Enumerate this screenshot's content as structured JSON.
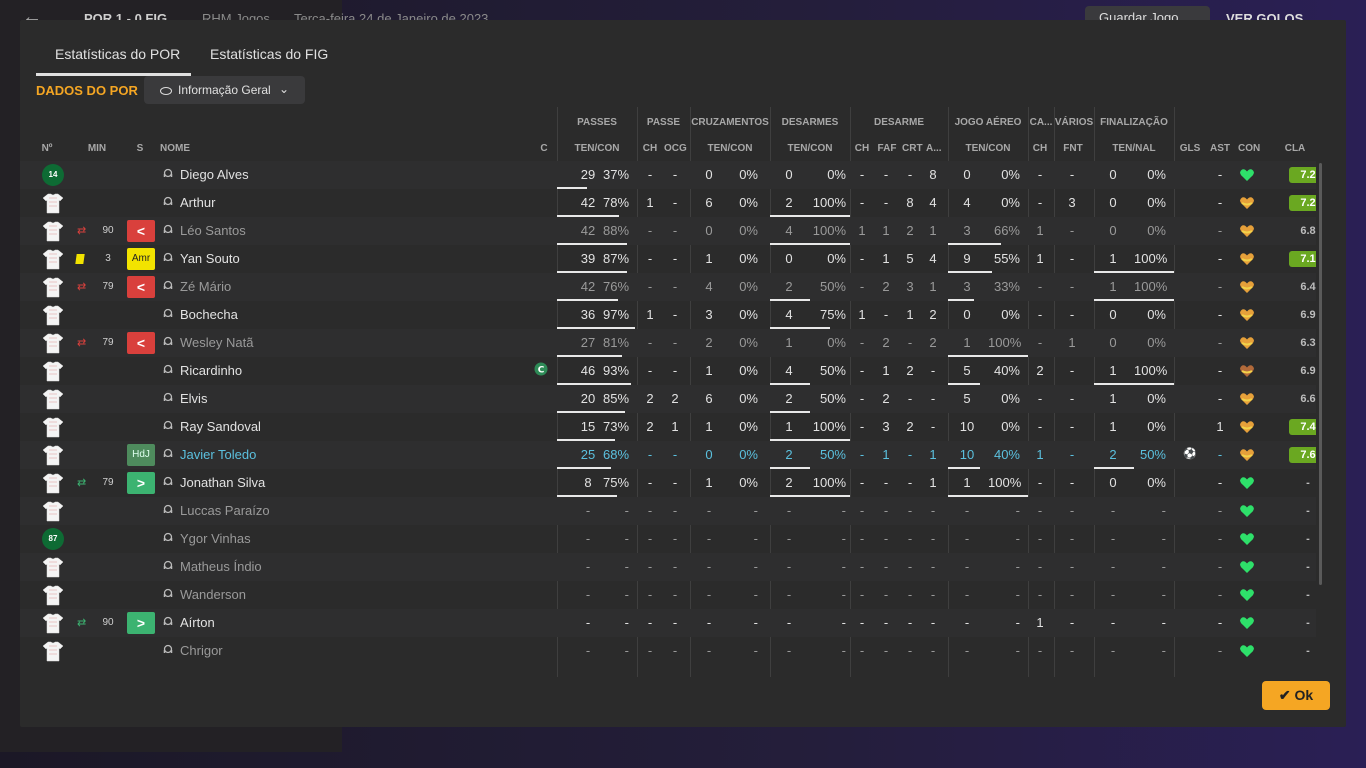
{
  "topbar": {
    "score": "POR  1 - 0  FIG",
    "team": "RHM Jogos",
    "date": "Terça-feira 24 de Janeiro de 2023",
    "save_label": "Guardar Jogo",
    "goals_label": "VER GOLOS"
  },
  "tabs": [
    "Estatísticas do POR",
    "Estatísticas do FIG"
  ],
  "section_title": "DADOS DO POR",
  "view_dropdown": {
    "value": "Informação Geral",
    "icon": "eye-icon"
  },
  "groups": [
    "PASSES",
    "PASSE",
    "CRUZAMENTOS",
    "DESARMES",
    "DESARME",
    "JOGO AÉREO",
    "CA...",
    "VÁRIOS",
    "FINALIZAÇÃO"
  ],
  "headers": [
    "Nº",
    "MIN",
    "S",
    "NOME",
    "C",
    "TEN/CON",
    "CH",
    "OCG",
    "TEN/CON",
    "TEN/CON",
    "CH",
    "FAF",
    "CRT",
    "A...",
    "TEN/CON",
    "CH",
    "FNT",
    "TEN/NAL",
    "GLS",
    "AST",
    "CON",
    "CLA"
  ],
  "colors": {
    "accent": "#f5a623",
    "rating_good": "#6aa821",
    "sub_out": "#d9403c",
    "sub_in": "#3cb371",
    "highlight": "#5bc0de"
  },
  "players": [
    {
      "num": "14",
      "gk": true,
      "min": "",
      "sub": "",
      "s": "",
      "name": "Diego Alves",
      "cap": false,
      "style": "",
      "v": [
        "29",
        "37%",
        "-",
        "-",
        "0",
        "0%",
        "0",
        "0%",
        "-",
        "-",
        "-",
        "8",
        "0",
        "0%",
        "-",
        "-",
        "0",
        "0%",
        "",
        "-"
      ],
      "pb": 0.37,
      "db": 0,
      "ab": 0,
      "fb": 0,
      "cla": "7.2",
      "good": true,
      "con": "green"
    },
    {
      "num": "",
      "gk": false,
      "min": "",
      "sub": "",
      "s": "",
      "name": "Arthur",
      "cap": false,
      "style": "",
      "v": [
        "42",
        "78%",
        "1",
        "-",
        "6",
        "0%",
        "2",
        "100%",
        "-",
        "-",
        "8",
        "4",
        "4",
        "0%",
        "-",
        "3",
        "0",
        "0%",
        "",
        "-"
      ],
      "pb": 0.78,
      "db": 1,
      "ab": 0,
      "fb": 0,
      "cla": "7.2",
      "good": true,
      "con": "orange"
    },
    {
      "num": "",
      "gk": false,
      "min": "90",
      "sub": "out",
      "s": "<",
      "name": "Léo Santos",
      "cap": false,
      "style": "dim",
      "v": [
        "42",
        "88%",
        "-",
        "-",
        "0",
        "0%",
        "4",
        "100%",
        "1",
        "1",
        "2",
        "1",
        "3",
        "66%",
        "1",
        "-",
        "0",
        "0%",
        "",
        "-"
      ],
      "pb": 0.88,
      "db": 1,
      "ab": 0.66,
      "fb": 0,
      "cla": "6.8",
      "good": false,
      "con": "orange"
    },
    {
      "num": "",
      "gk": false,
      "min": "3",
      "sub": "yellow",
      "s": "Amr",
      "name": "Yan Souto",
      "cap": false,
      "style": "",
      "v": [
        "39",
        "87%",
        "-",
        "-",
        "1",
        "0%",
        "0",
        "0%",
        "-",
        "1",
        "5",
        "4",
        "9",
        "55%",
        "1",
        "-",
        "1",
        "100%",
        "",
        "-"
      ],
      "pb": 0.87,
      "db": 0,
      "ab": 0.55,
      "fb": 1,
      "cla": "7.1",
      "good": true,
      "con": "orange"
    },
    {
      "num": "",
      "gk": false,
      "min": "79",
      "sub": "out",
      "s": "<",
      "name": "Zé Mário",
      "cap": false,
      "style": "dim",
      "v": [
        "42",
        "76%",
        "-",
        "-",
        "4",
        "0%",
        "2",
        "50%",
        "-",
        "2",
        "3",
        "1",
        "3",
        "33%",
        "-",
        "-",
        "1",
        "100%",
        "",
        "-"
      ],
      "pb": 0.76,
      "db": 0.5,
      "ab": 0.33,
      "fb": 1,
      "cla": "6.4",
      "good": false,
      "con": "orange"
    },
    {
      "num": "",
      "gk": false,
      "min": "",
      "sub": "",
      "s": "",
      "name": "Bochecha",
      "cap": false,
      "style": "",
      "v": [
        "36",
        "97%",
        "1",
        "-",
        "3",
        "0%",
        "4",
        "75%",
        "1",
        "-",
        "1",
        "2",
        "0",
        "0%",
        "-",
        "-",
        "0",
        "0%",
        "",
        "-"
      ],
      "pb": 0.97,
      "db": 0.75,
      "ab": 0,
      "fb": 0,
      "cla": "6.9",
      "good": false,
      "con": "orange"
    },
    {
      "num": "",
      "gk": false,
      "min": "79",
      "sub": "out",
      "s": "<",
      "name": "Wesley Natã",
      "cap": false,
      "style": "dim",
      "v": [
        "27",
        "81%",
        "-",
        "-",
        "2",
        "0%",
        "1",
        "0%",
        "-",
        "2",
        "-",
        "2",
        "1",
        "100%",
        "-",
        "1",
        "0",
        "0%",
        "",
        "-"
      ],
      "pb": 0.81,
      "db": 0,
      "ab": 1,
      "fb": 0,
      "cla": "6.3",
      "good": false,
      "con": "orange"
    },
    {
      "num": "",
      "gk": false,
      "min": "",
      "sub": "",
      "s": "",
      "name": "Ricardinho",
      "cap": true,
      "style": "",
      "v": [
        "46",
        "93%",
        "-",
        "-",
        "1",
        "0%",
        "4",
        "50%",
        "-",
        "1",
        "2",
        "-",
        "5",
        "40%",
        "2",
        "-",
        "1",
        "100%",
        "",
        "-"
      ],
      "pb": 0.93,
      "db": 0.5,
      "ab": 0.4,
      "fb": 1,
      "cla": "6.9",
      "good": false,
      "con": "brown"
    },
    {
      "num": "",
      "gk": false,
      "min": "",
      "sub": "",
      "s": "",
      "name": "Elvis",
      "cap": false,
      "style": "",
      "v": [
        "20",
        "85%",
        "2",
        "2",
        "6",
        "0%",
        "2",
        "50%",
        "-",
        "2",
        "-",
        "-",
        "5",
        "0%",
        "-",
        "-",
        "1",
        "0%",
        "",
        "-"
      ],
      "pb": 0.85,
      "db": 0.5,
      "ab": 0,
      "fb": 0,
      "cla": "6.6",
      "good": false,
      "con": "orange"
    },
    {
      "num": "",
      "gk": false,
      "min": "",
      "sub": "",
      "s": "",
      "name": "Ray Sandoval",
      "cap": false,
      "style": "",
      "v": [
        "15",
        "73%",
        "2",
        "1",
        "1",
        "0%",
        "1",
        "100%",
        "-",
        "3",
        "2",
        "-",
        "10",
        "0%",
        "-",
        "-",
        "1",
        "0%",
        "",
        "1"
      ],
      "pb": 0.73,
      "db": 1,
      "ab": 0,
      "fb": 0,
      "cla": "7.4",
      "good": true,
      "con": "orange"
    },
    {
      "num": "",
      "gk": false,
      "min": "",
      "sub": "",
      "s": "HdJ",
      "name": "Javier Toledo",
      "cap": false,
      "style": "hl",
      "v": [
        "25",
        "68%",
        "-",
        "-",
        "0",
        "0%",
        "2",
        "50%",
        "-",
        "1",
        "-",
        "1",
        "10",
        "40%",
        "1",
        "-",
        "2",
        "50%",
        "ball",
        "-"
      ],
      "pb": 0.68,
      "db": 0.5,
      "ab": 0.4,
      "fb": 0.5,
      "cla": "7.6",
      "good": true,
      "con": "orange"
    },
    {
      "num": "",
      "gk": false,
      "min": "79",
      "sub": "in",
      "s": ">",
      "name": "Jonathan Silva",
      "cap": false,
      "style": "",
      "v": [
        "8",
        "75%",
        "-",
        "-",
        "1",
        "0%",
        "2",
        "100%",
        "-",
        "-",
        "-",
        "1",
        "1",
        "100%",
        "-",
        "-",
        "0",
        "0%",
        "",
        "-"
      ],
      "pb": 0.75,
      "db": 1,
      "ab": 1,
      "fb": 0,
      "cla": "-",
      "good": false,
      "con": "green"
    },
    {
      "num": "",
      "gk": false,
      "min": "",
      "sub": "",
      "s": "",
      "name": "Luccas Paraízo",
      "cap": false,
      "style": "dim",
      "v": [
        "-",
        "-",
        "-",
        "-",
        "-",
        "-",
        "-",
        "-",
        "-",
        "-",
        "-",
        "-",
        "-",
        "-",
        "-",
        "-",
        "-",
        "-",
        "",
        "-"
      ],
      "pb": 0,
      "db": 0,
      "ab": 0,
      "fb": 0,
      "cla": "-",
      "good": false,
      "con": "green"
    },
    {
      "num": "87",
      "gk": true,
      "min": "",
      "sub": "",
      "s": "",
      "name": "Ygor Vinhas",
      "cap": false,
      "style": "dim",
      "v": [
        "-",
        "-",
        "-",
        "-",
        "-",
        "-",
        "-",
        "-",
        "-",
        "-",
        "-",
        "-",
        "-",
        "-",
        "-",
        "-",
        "-",
        "-",
        "",
        "-"
      ],
      "pb": 0,
      "db": 0,
      "ab": 0,
      "fb": 0,
      "cla": "-",
      "good": false,
      "con": "green"
    },
    {
      "num": "",
      "gk": false,
      "min": "",
      "sub": "",
      "s": "",
      "name": "Matheus Índio",
      "cap": false,
      "style": "dim",
      "v": [
        "-",
        "-",
        "-",
        "-",
        "-",
        "-",
        "-",
        "-",
        "-",
        "-",
        "-",
        "-",
        "-",
        "-",
        "-",
        "-",
        "-",
        "-",
        "",
        "-"
      ],
      "pb": 0,
      "db": 0,
      "ab": 0,
      "fb": 0,
      "cla": "-",
      "good": false,
      "con": "green"
    },
    {
      "num": "",
      "gk": false,
      "min": "",
      "sub": "",
      "s": "",
      "name": "Wanderson",
      "cap": false,
      "style": "dim",
      "v": [
        "-",
        "-",
        "-",
        "-",
        "-",
        "-",
        "-",
        "-",
        "-",
        "-",
        "-",
        "-",
        "-",
        "-",
        "-",
        "-",
        "-",
        "-",
        "",
        "-"
      ],
      "pb": 0,
      "db": 0,
      "ab": 0,
      "fb": 0,
      "cla": "-",
      "good": false,
      "con": "green"
    },
    {
      "num": "",
      "gk": false,
      "min": "90",
      "sub": "in",
      "s": ">",
      "name": "Aírton",
      "cap": false,
      "style": "",
      "v": [
        "-",
        "-",
        "-",
        "-",
        "-",
        "-",
        "-",
        "-",
        "-",
        "-",
        "-",
        "-",
        "-",
        "-",
        "1",
        "-",
        "-",
        "-",
        "",
        "-"
      ],
      "pb": 0,
      "db": 0,
      "ab": 0,
      "fb": 0,
      "cla": "-",
      "good": false,
      "con": "green"
    },
    {
      "num": "",
      "gk": false,
      "min": "",
      "sub": "",
      "s": "",
      "name": "Chrigor",
      "cap": false,
      "style": "dim",
      "v": [
        "-",
        "-",
        "-",
        "-",
        "-",
        "-",
        "-",
        "-",
        "-",
        "-",
        "-",
        "-",
        "-",
        "-",
        "-",
        "-",
        "-",
        "-",
        "",
        "-"
      ],
      "pb": 0,
      "db": 0,
      "ab": 0,
      "fb": 0,
      "cla": "-",
      "good": false,
      "con": "green"
    }
  ],
  "ok_label": "Ok"
}
